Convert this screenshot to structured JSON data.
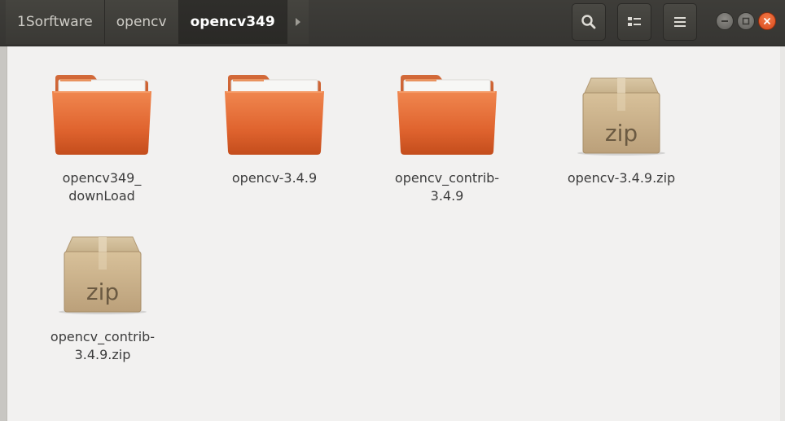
{
  "breadcrumbs": [
    "1Sorftware",
    "opencv",
    "opencv349"
  ],
  "colors": {
    "header_bg": "#3b3a36",
    "folder_orange": "#e0642f",
    "background": "#f2f1f0",
    "close_button": "#e95420"
  },
  "toolbar": {
    "search_icon": "search-icon",
    "view_icon": "list-view-icon",
    "menu_icon": "hamburger-menu-icon"
  },
  "files": [
    {
      "name": "opencv349_\ndownLoad",
      "type": "folder"
    },
    {
      "name": "opencv-3.4.9",
      "type": "folder"
    },
    {
      "name": "opencv_contrib-\n3.4.9",
      "type": "folder"
    },
    {
      "name": "opencv-3.4.9.zip",
      "type": "zip",
      "badge": "zip"
    },
    {
      "name": "opencv_contrib-\n3.4.9.zip",
      "type": "zip",
      "badge": "zip"
    }
  ]
}
